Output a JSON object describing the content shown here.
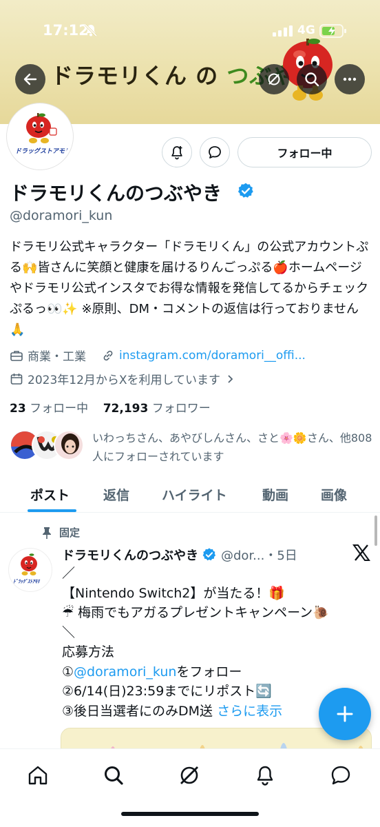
{
  "status_bar": {
    "time": "17:12",
    "network": "4G"
  },
  "banner": {
    "title_part1": "ドラモリくん",
    "title_part2": " の ",
    "title_part3": "つぶやき"
  },
  "profile": {
    "follow_button": "フォロー中",
    "display_name": "ドラモリくんのつぶやき",
    "handle": "@doramori_kun",
    "bio": "ドラモリ公式キャラクター「ドラモリくん」の公式アカウントぷる🙌皆さんに笑顔と健康を届けるりんごっぷる🍎ホームページやドラモリ公式インスタでお得な情報を発信してるからチェックぷるっ👀✨ ※原則、DM・コメントの返信は行っておりません🙏",
    "category": "商業・工業",
    "link": "instagram.com/doramori__offi...",
    "joined": "2023年12月からXを利用しています",
    "following_count": "23",
    "following_label": "フォロー中",
    "followers_count": "72,193",
    "followers_label": "フォロワー",
    "known_followers_text": "いわっちさん、あやびしんさん、さと🌸🌼さん、他808人にフォローされています"
  },
  "tabs": [
    {
      "label": "ポスト"
    },
    {
      "label": "返信"
    },
    {
      "label": "ハイライト"
    },
    {
      "label": "動画"
    },
    {
      "label": "画像"
    }
  ],
  "pinned_post": {
    "pinned_label": "固定",
    "author_name": "ドラモリくんのつぶやき",
    "author_sub": "@dor...・5日",
    "line1": "／",
    "line2": "【Nintendo Switch2】が当たる！🎁",
    "line3": "☔ 梅雨でもアガるプレゼントキャンペーン🐌",
    "line4": "＼",
    "line5": "応募方法",
    "line6_prefix": "①",
    "line6_mention": "@doramori_kun",
    "line6_suffix": "をフォロー",
    "line7": "②6/14(日)23:59までにリポスト🔄",
    "line8": "③後日当選者にのみDM送 ",
    "show_more": "さらに表示"
  },
  "avatar_logo_text": "ドラッグストアモリ",
  "colors": {
    "accent": "#1d9bf0",
    "text": "#0f1419",
    "muted": "#536471",
    "banner": "#ece2ae"
  }
}
